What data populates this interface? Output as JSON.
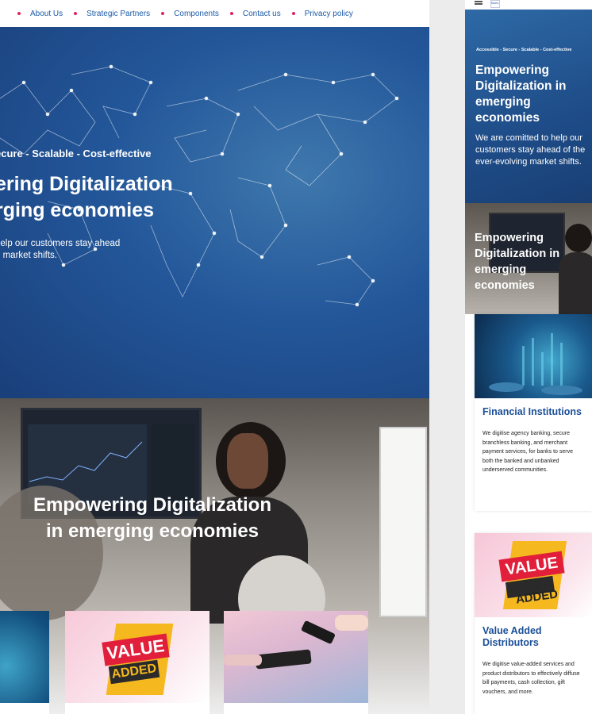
{
  "nav": {
    "items": [
      "About Us",
      "Strategic Partners",
      "Components",
      "Contact us",
      "Privacy policy"
    ]
  },
  "hero": {
    "tagline": "ecure  -  Scalable  -  Cost-effective",
    "headline_1": "ering Digitalization",
    "headline_2": "rging economies",
    "sub_1": " help our customers stay ahead",
    "sub_2": "g market shifts."
  },
  "hero2": {
    "headline_1": "Empowering Digitalization",
    "headline_2": "in emerging economies"
  },
  "cards": {
    "value_word": "VALUE",
    "added_word": "ADDED"
  },
  "mobile": {
    "logo": "fisms",
    "tagline": "Accessible  -  Secure  -  Scalable  -  Cost-effective",
    "headline": "Empowering Digitalization in emerging economies",
    "sub": "We are comitted to help our customers stay ahead of the ever-evolving market shifts.",
    "hero2_headline": "Empowering Digitalization in emerging economies",
    "card1_title": "Financial Institutions",
    "card1_desc": "We digitise agency banking, secure branchless banking, and merchant payment services, for banks to serve both the banked and unbanked underserved communities.",
    "card2_title": "Value Added Distributors",
    "card2_desc": "We digitise value-added services and product distributors to effectively diffuse bill payments, cash collection, gift vouchers, and more."
  },
  "colors": {
    "brand_blue": "#1b5aa6",
    "accent_red": "#e0245e",
    "title_blue": "#1b4f98"
  }
}
